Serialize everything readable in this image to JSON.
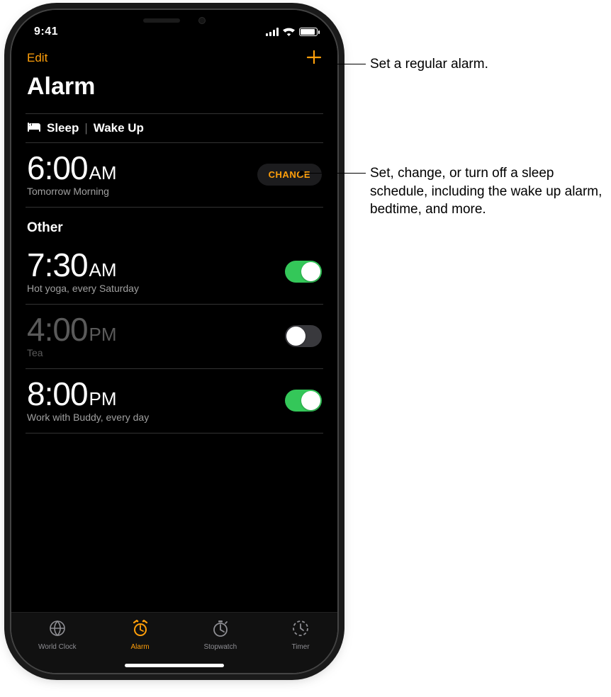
{
  "status": {
    "time": "9:41"
  },
  "nav": {
    "edit": "Edit",
    "add_icon": "+"
  },
  "title": "Alarm",
  "sleep": {
    "header_prefix": "Sleep",
    "header_sep": "|",
    "header_suffix": "Wake Up",
    "time": "6:00",
    "ampm": "AM",
    "sub": "Tomorrow Morning",
    "change": "CHANGE"
  },
  "other_label": "Other",
  "alarms": [
    {
      "time": "7:30",
      "ampm": "AM",
      "sub": "Hot yoga, every Saturday",
      "on": true
    },
    {
      "time": "4:00",
      "ampm": "PM",
      "sub": "Tea",
      "on": false
    },
    {
      "time": "8:00",
      "ampm": "PM",
      "sub": "Work with Buddy, every day",
      "on": true
    }
  ],
  "tabs": [
    {
      "label": "World Clock",
      "active": false
    },
    {
      "label": "Alarm",
      "active": true
    },
    {
      "label": "Stopwatch",
      "active": false
    },
    {
      "label": "Timer",
      "active": false
    }
  ],
  "callouts": {
    "c1": "Set a regular alarm.",
    "c2": "Set, change, or turn off a sleep schedule, including the wake up alarm, bedtime, and more."
  }
}
